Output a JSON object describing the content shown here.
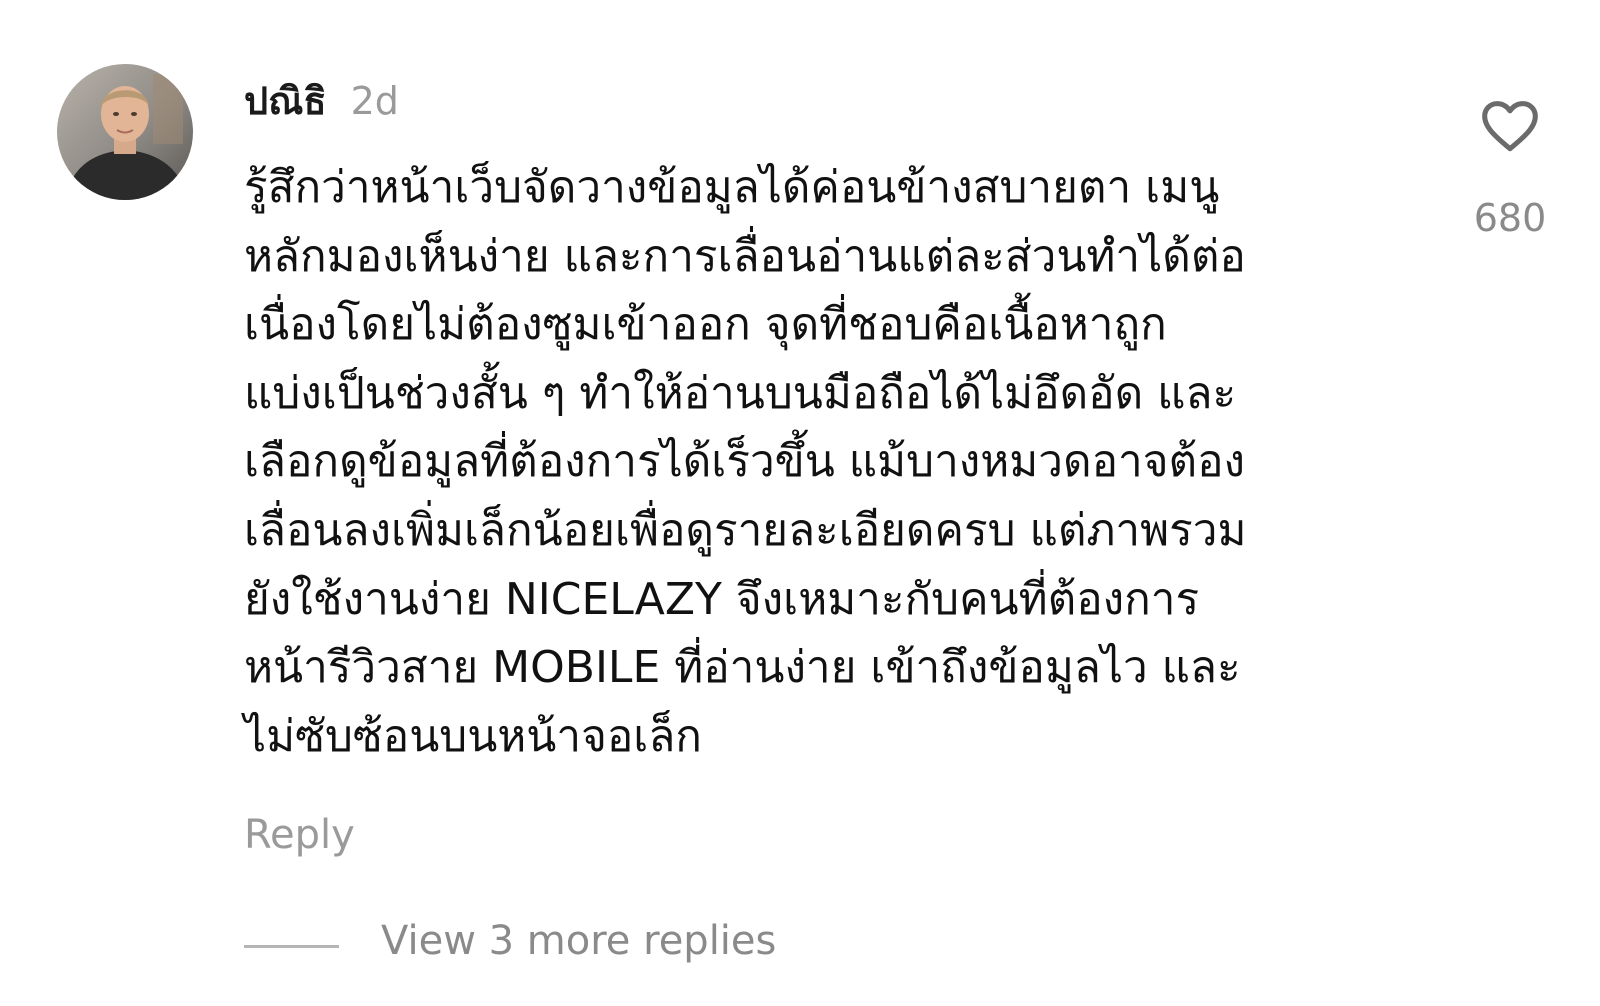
{
  "comment": {
    "username": "ปณิธิ",
    "timestamp": "2d",
    "lines": [
      "รู้สึกว่าหน้าเว็บจัดวางข้อมูลได้ค่อนข้างสบายตา เมนู",
      "หลักมองเห็นง่าย และการเลื่อนอ่านแต่ละส่วนทำได้ต่อ",
      "เนื่องโดยไม่ต้องซูมเข้าออก จุดที่ชอบคือเนื้อหาถูก",
      "แบ่งเป็นช่วงสั้น ๆ ทำให้อ่านบนมือถือได้ไม่อึดอัด และ",
      "เลือกดูข้อมูลที่ต้องการได้เร็วขึ้น แม้บางหมวดอาจต้อง",
      "เลื่อนลงเพิ่มเล็กน้อยเพื่อดูรายละเอียดครบ แต่ภาพรวม",
      "ยังใช้งานง่าย NICELAZY จึงเหมาะกับคนที่ต้องการ",
      "หน้ารีวิวสาย MOBILE ที่อ่านง่าย เข้าถึงข้อมูลไว และ",
      "ไม่ซับซ้อนบนหน้าจอเล็ก"
    ],
    "like_icon": "heart-outline-icon",
    "like_count": "680",
    "reply_label": "Reply",
    "view_replies_label": "View 3 more replies"
  }
}
